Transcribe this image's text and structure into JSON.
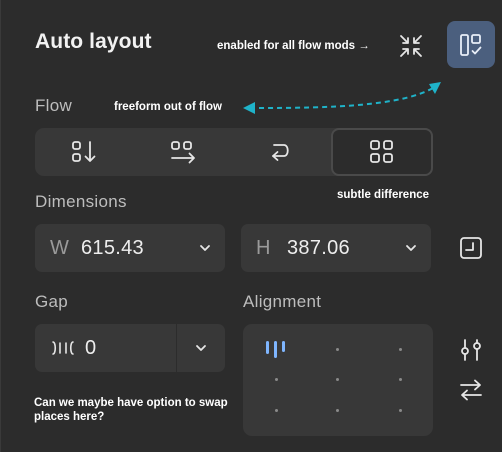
{
  "panel": {
    "title": "Auto layout"
  },
  "annotations": {
    "enabled_note": "enabled for all flow mods →",
    "freeform_note": "freeform out of flow",
    "subtle_note": "subtle difference",
    "swap_note": "Can we maybe have option to swap places here?"
  },
  "flow": {
    "label": "Flow",
    "options": [
      {
        "icon": "vertical-flow-icon",
        "active": false
      },
      {
        "icon": "horizontal-flow-icon",
        "active": false
      },
      {
        "icon": "wrap-flow-icon",
        "active": false
      },
      {
        "icon": "grid-flow-icon",
        "active": true
      }
    ]
  },
  "dimensions": {
    "label": "Dimensions",
    "width": {
      "prefix": "W",
      "value": "615.43"
    },
    "height": {
      "prefix": "H",
      "value": "387.06"
    }
  },
  "gap": {
    "label": "Gap",
    "value": "0"
  },
  "alignment": {
    "label": "Alignment",
    "selected": "top-left"
  },
  "colors": {
    "background": "#2c2c2c",
    "field": "#383838",
    "accent": "#7fb6ff",
    "toggle_active": "#4b5f7e",
    "annotation_arrow": "#1fb3c9"
  }
}
